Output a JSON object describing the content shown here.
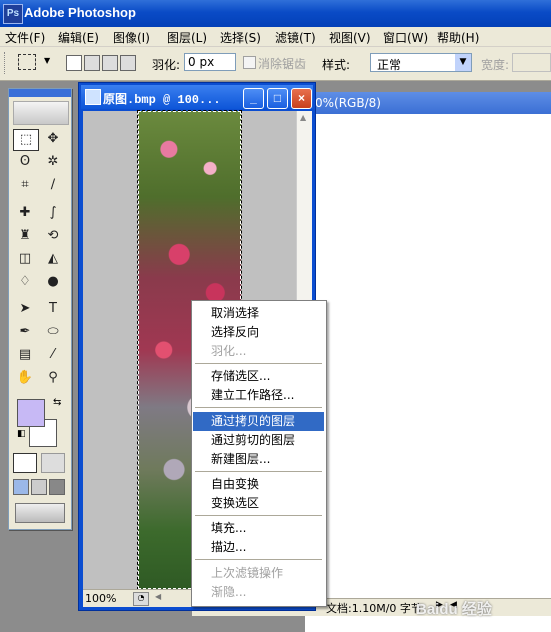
{
  "app": {
    "title": "Adobe Photoshop",
    "icon": "photoshop-icon"
  },
  "menu": [
    "文件(F)",
    "编辑(E)",
    "图像(I)",
    "图层(L)",
    "选择(S)",
    "滤镜(T)",
    "视图(V)",
    "窗口(W)",
    "帮助(H)"
  ],
  "options": {
    "feather_label": "羽化:",
    "feather_value": "0 px",
    "antialias_label": "消除锯齿",
    "style_label": "样式:",
    "style_value": "正常",
    "width_label": "宽度:"
  },
  "document": {
    "title": "原图.bmp @ 100...",
    "zoom": "100%",
    "buttons": {
      "minimize": "_",
      "maximize": "□",
      "close": "×"
    }
  },
  "second_document": {
    "title_fragment": "0%(RGB/8)",
    "zoom": "100%",
    "status": "文档:1.10M/0 字节"
  },
  "context_menu": {
    "items": [
      {
        "label": "取消选择",
        "disabled": false
      },
      {
        "label": "选择反向",
        "disabled": false
      },
      {
        "label": "羽化...",
        "disabled": true
      },
      {
        "label": "存储选区...",
        "disabled": false
      },
      {
        "label": "建立工作路径...",
        "disabled": false
      },
      {
        "label": "通过拷贝的图层",
        "disabled": false,
        "highlighted": true
      },
      {
        "label": "通过剪切的图层",
        "disabled": false
      },
      {
        "label": "新建图层...",
        "disabled": false
      },
      {
        "label": "自由变换",
        "disabled": false
      },
      {
        "label": "变换选区",
        "disabled": false
      },
      {
        "label": "填充...",
        "disabled": false
      },
      {
        "label": "描边...",
        "disabled": false
      },
      {
        "label": "上次滤镜操作",
        "disabled": true
      },
      {
        "label": "渐隐...",
        "disabled": true
      }
    ]
  },
  "watermark": "Baidu 经验",
  "colors": {
    "foreground": "#c7b9f5",
    "background": "#ffffff",
    "highlight": "#316ac5",
    "titlebar": "#0a4bc6"
  }
}
